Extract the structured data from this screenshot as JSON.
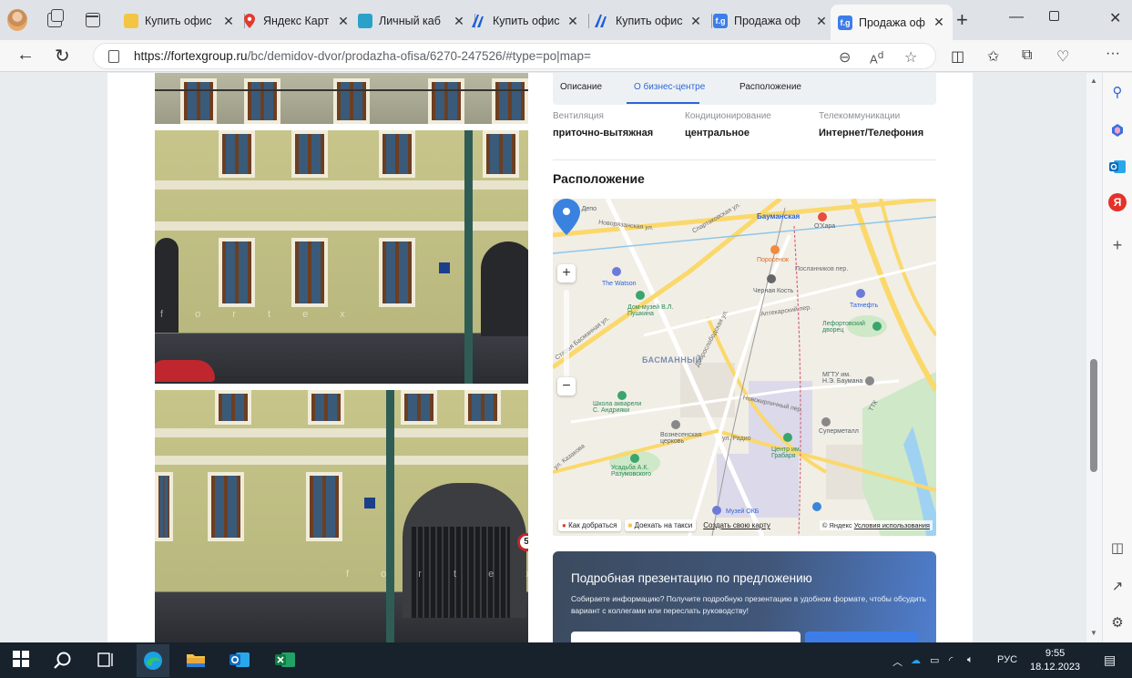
{
  "browser": {
    "tabs": [
      {
        "title": "Купить офис",
        "favicon_color": "#f4c542",
        "favicon_glyph": ""
      },
      {
        "title": "Яндекс Карт",
        "favicon_color": "#e23b2e",
        "favicon_glyph": ""
      },
      {
        "title": "Личный каб",
        "favicon_color": "#2aa1c9",
        "favicon_glyph": ""
      },
      {
        "title": "Купить офис",
        "favicon_color": "#1e5fd6",
        "favicon_glyph": ""
      },
      {
        "title": "Купить офис",
        "favicon_color": "#1e5fd6",
        "favicon_glyph": ""
      },
      {
        "title": "Продажа оф",
        "favicon_color": "#3d7de8",
        "favicon_glyph": "f.g"
      },
      {
        "title": "Продажа оф",
        "favicon_color": "#3d7de8",
        "favicon_glyph": "f.g"
      }
    ],
    "url_host": "https://fortexgroup.ru",
    "url_path": "/bc/demidov-dvor/prodazha-ofisa/6270-247526/#type=po|map=",
    "tab_close_glyph": "✕",
    "new_tab_glyph": "+"
  },
  "page": {
    "tabs": [
      {
        "label": "Описание"
      },
      {
        "label": "О бизнес-центре"
      },
      {
        "label": "Расположение"
      }
    ],
    "specs": [
      {
        "key": "Вентиляция",
        "value": "приточно-вытяжная"
      },
      {
        "key": "Кондиционирование",
        "value": "центральное"
      },
      {
        "key": "Телекоммуникации",
        "value": "Интернет/Телефония"
      }
    ],
    "location_title": "Расположение",
    "photo_watermark": "f o r t e x",
    "sign_number": "5",
    "map": {
      "labels": {
        "station": "вокзала, Депо",
        "metro": "Бауманская",
        "oxara": "О'Хара",
        "novoryazan": "Новорязанская ул.",
        "spartak": "Спартаковская ул.",
        "poroseno": "Поросенок",
        "watson": "The Watson",
        "dom_muzey": "Дом-музей В.Л. Пушкина",
        "chernaya": "Черная Кость",
        "posl": "Посланников пер.",
        "tatneft": "Татнефть",
        "lefort": "Лефортовский дворец",
        "aptekarsky": "Аптекарский пер.",
        "staraya": "Старая Басманная ул.",
        "basmanny": "БАСМАННЫЙ",
        "dobroslob": "Доброслободская ул.",
        "mgtu": "МГТУ им. Н.Э. Баумана",
        "shkola": "Школа акварели С. Андрияки",
        "voznes": "Вознесенская церковь",
        "radio": "ул. Радио",
        "tsentr": "Центр им. Грабаря",
        "supermetall": "Суперметалл",
        "usadba": "Усадьба А.К. Разумовского",
        "kazakova": "ул. Казакова",
        "muzey_okb": "Музей ОКБ",
        "ttk": "ТТК",
        "novokurg": "Новокирпичный пер."
      },
      "route_btn": "Как добраться",
      "taxi_btn": "Доехать на такси",
      "create_link": "Создать свою карту",
      "copyright_prefix": "© Яндекс",
      "terms": "Условия использования",
      "zoom_in": "+",
      "zoom_out": "−"
    },
    "promo": {
      "title": "Подробная презентацию по предложению",
      "text": "Собираете информацию? Получите подробную презентацию в удобном формате, чтобы обсудить вариант с коллегами или переслать руководству!"
    }
  },
  "sidebar": {
    "items": [
      "search-icon",
      "copilot-icon",
      "outlook-icon",
      "yandex-icon",
      "add-icon"
    ],
    "yandex_glyph": "Я",
    "add_glyph": "+"
  },
  "taskbar": {
    "lang": "РУС",
    "time": "9:55",
    "date": "18.12.2023"
  }
}
